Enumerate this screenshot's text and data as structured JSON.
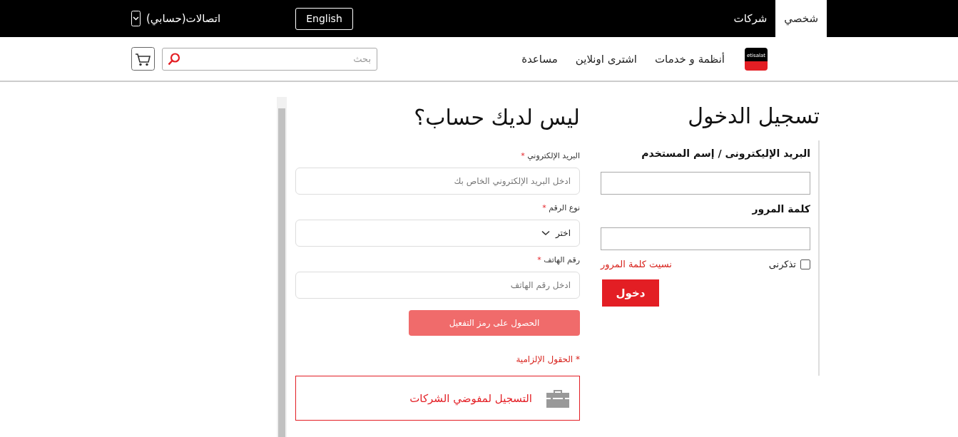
{
  "top_bar": {
    "segments": [
      {
        "label": "شخصي",
        "selected": true
      },
      {
        "label": "شركات",
        "selected": false
      }
    ],
    "language_button": "English",
    "account_menu": "اتصالات(حسابي)"
  },
  "nav": {
    "logo_text": "etisalat",
    "items": [
      "أنظمة و خدمات",
      "اشترى اونلاين",
      "مساعدة"
    ],
    "search": {
      "placeholder": "بحث"
    }
  },
  "login": {
    "title": "تسجيل الدخول",
    "username_label": "البريد الإليكترونى / إسم المستخدم",
    "password_label": "كلمة المرور",
    "remember_me": {
      "label": "تذكرنى",
      "checked": false
    },
    "forgot_link": "نسيت كلمة المرور",
    "submit": "دخول"
  },
  "register": {
    "title": "ليس لديك حساب؟",
    "fields": [
      {
        "kind": "text",
        "label": "البريد الإلكتروني",
        "required_mark": "*",
        "placeholder": "ادخل البريد الإلكتروني الخاص بك"
      },
      {
        "kind": "select",
        "label": "نوع الرقم",
        "required_mark": "*",
        "value": "اختر"
      },
      {
        "kind": "text",
        "label": "رقم الهاتف",
        "required_mark": "*",
        "placeholder": "ادخل رقم الهاتف"
      }
    ],
    "otp_button": {
      "label": "الحصول على رمز التفعيل",
      "disabled": true
    },
    "required_note": "* الحقول الإلزامية",
    "business_link": "التسجيل لمفوضي الشركات"
  }
}
